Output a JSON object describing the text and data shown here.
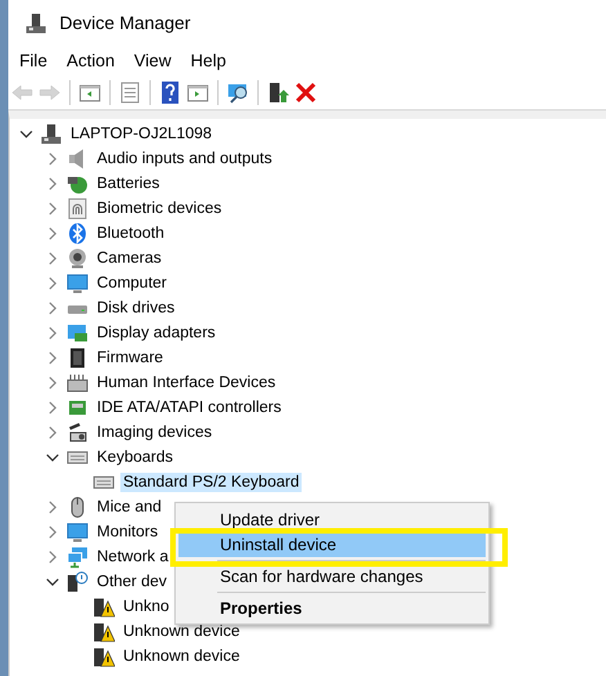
{
  "window": {
    "title": "Device Manager"
  },
  "menu_bar": [
    "File",
    "Action",
    "View",
    "Help"
  ],
  "toolbar": [
    {
      "kind": "back",
      "disabled": true
    },
    {
      "kind": "forward",
      "disabled": true
    },
    {
      "kind": "separator"
    },
    {
      "kind": "console-tree",
      "disabled": false
    },
    {
      "kind": "separator"
    },
    {
      "kind": "properties",
      "disabled": false
    },
    {
      "kind": "separator"
    },
    {
      "kind": "help",
      "disabled": false
    },
    {
      "kind": "action-pane",
      "disabled": false
    },
    {
      "kind": "separator"
    },
    {
      "kind": "scan",
      "disabled": false
    },
    {
      "kind": "separator"
    },
    {
      "kind": "update",
      "disabled": false
    },
    {
      "kind": "uninstall",
      "disabled": false
    }
  ],
  "tree": [
    {
      "label": "LAPTOP-OJ2L1098",
      "kind": "computer-tower",
      "expanded": true,
      "selected": false,
      "children": [
        {
          "label": "Audio inputs and outputs",
          "kind": "speaker",
          "expanded": false,
          "selected": false
        },
        {
          "label": "Batteries",
          "kind": "battery",
          "expanded": false,
          "selected": false
        },
        {
          "label": "Biometric devices",
          "kind": "fingerprint",
          "expanded": false,
          "selected": false
        },
        {
          "label": "Bluetooth",
          "kind": "bluetooth",
          "expanded": false,
          "selected": false
        },
        {
          "label": "Cameras",
          "kind": "camera",
          "expanded": false,
          "selected": false
        },
        {
          "label": "Computer",
          "kind": "monitor",
          "expanded": false,
          "selected": false
        },
        {
          "label": "Disk drives",
          "kind": "disk",
          "expanded": false,
          "selected": false
        },
        {
          "label": "Display adapters",
          "kind": "display-adapter",
          "expanded": false,
          "selected": false
        },
        {
          "label": "Firmware",
          "kind": "chip",
          "expanded": false,
          "selected": false
        },
        {
          "label": "Human Interface Devices",
          "kind": "hid",
          "expanded": false,
          "selected": false
        },
        {
          "label": "IDE ATA/ATAPI controllers",
          "kind": "controller",
          "expanded": false,
          "selected": false
        },
        {
          "label": "Imaging devices",
          "kind": "scanner",
          "expanded": false,
          "selected": false
        },
        {
          "label": "Keyboards",
          "kind": "keyboard",
          "expanded": true,
          "selected": false,
          "children": [
            {
              "label": "Standard PS/2 Keyboard",
              "kind": "keyboard",
              "selected": true
            }
          ]
        },
        {
          "label": "Mice and",
          "kind": "mouse",
          "expanded": false,
          "selected": false
        },
        {
          "label": "Monitors",
          "kind": "monitor",
          "expanded": false,
          "selected": false
        },
        {
          "label": "Network a",
          "kind": "network",
          "expanded": false,
          "selected": false
        },
        {
          "label": "Other dev",
          "kind": "unknown-group",
          "expanded": true,
          "selected": false,
          "children": [
            {
              "label": "Unkno",
              "kind": "warning-device",
              "selected": false
            },
            {
              "label": "Unknown device",
              "kind": "warning-device",
              "selected": false
            },
            {
              "label": "Unknown device",
              "kind": "warning-device",
              "selected": false
            }
          ]
        }
      ]
    }
  ],
  "context_menu": [
    {
      "kind": "item",
      "label": "Update driver",
      "selected": false,
      "default": false
    },
    {
      "kind": "item",
      "label": "Uninstall device",
      "selected": true,
      "default": false
    },
    {
      "kind": "separator"
    },
    {
      "kind": "item",
      "label": "Scan for hardware changes",
      "selected": false,
      "default": false
    },
    {
      "kind": "separator"
    },
    {
      "kind": "item",
      "label": "Properties",
      "selected": false,
      "default": true
    }
  ],
  "annotation": {
    "kind": "highlight-frame",
    "color": "#ffee00"
  }
}
